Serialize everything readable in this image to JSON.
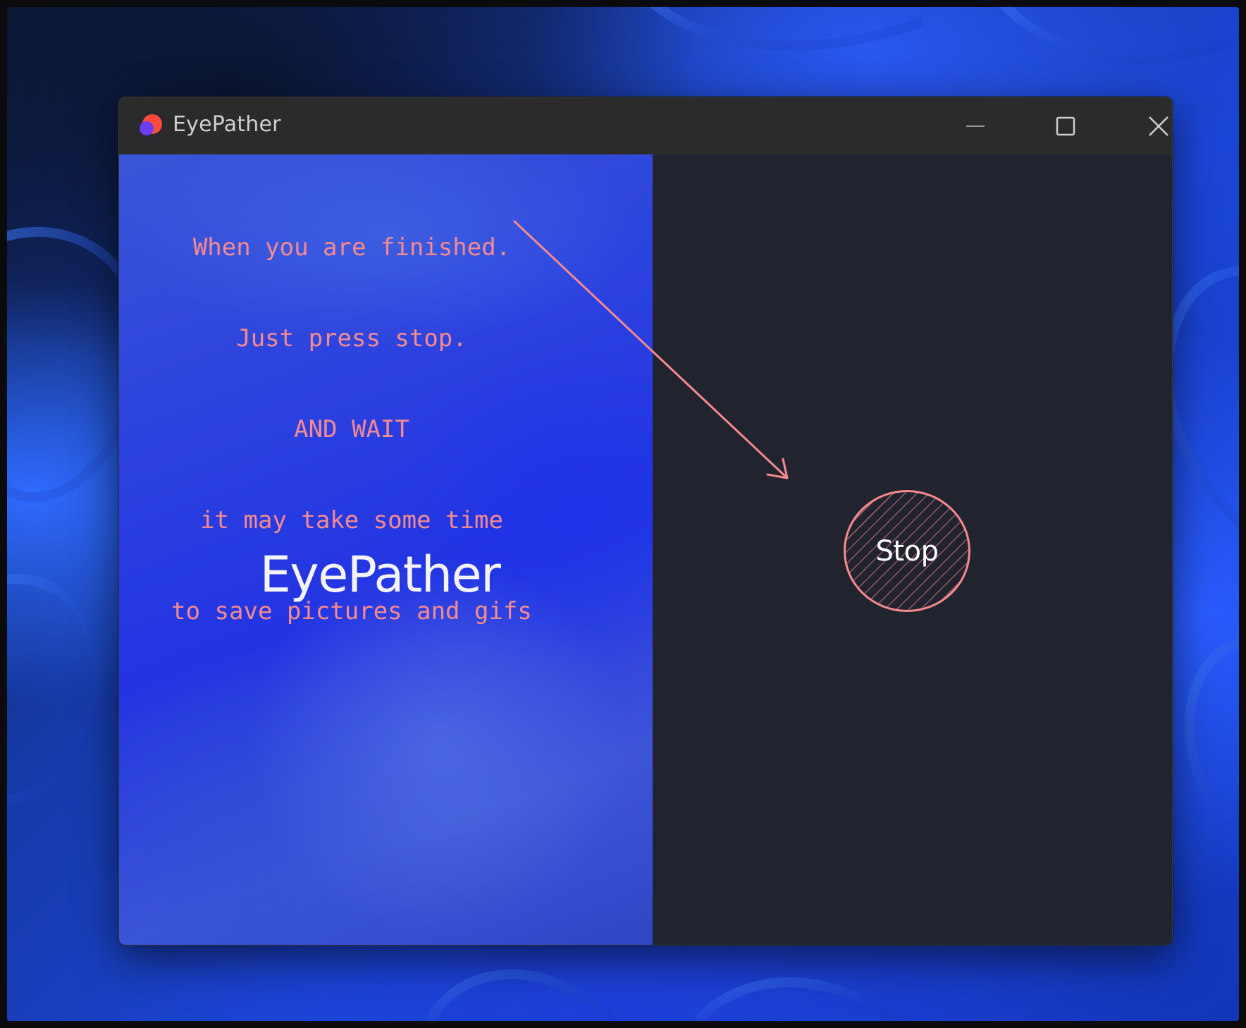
{
  "window": {
    "title": "EyePather"
  },
  "left_panel": {
    "instructions": [
      "When you are finished.",
      "Just press stop.",
      "AND WAIT",
      "it may take some time",
      "to save pictures and gifs"
    ],
    "brand_name": "EyePather"
  },
  "right_panel": {
    "stop_label": "Stop"
  },
  "colors": {
    "accent": "#f48a8e",
    "titlebar": "#2b2b2b",
    "right_panel_bg": "#21232f",
    "left_panel_blue": "#2234e2"
  },
  "icons": {
    "app": "app-logo-icon",
    "minimize": "minimize-icon",
    "maximize": "maximize-icon",
    "close": "close-icon"
  }
}
